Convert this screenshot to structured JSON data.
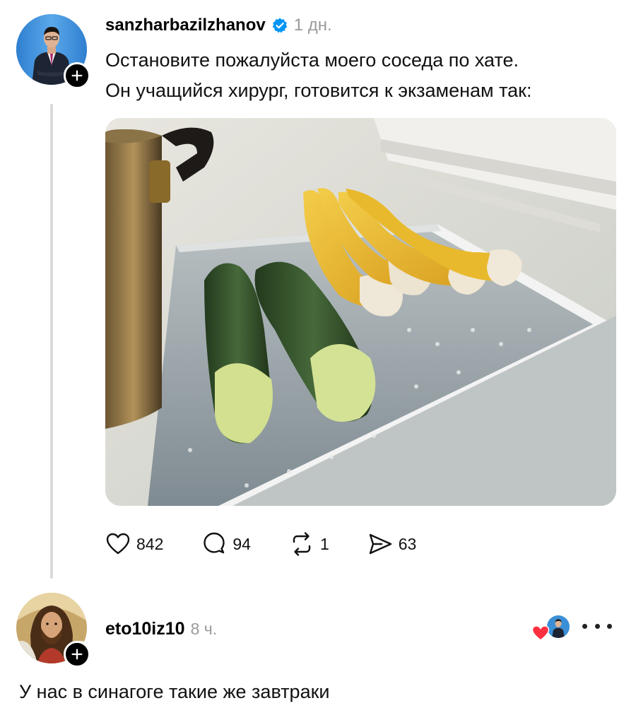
{
  "post": {
    "author": "sanzharbazilzhanov",
    "verified": true,
    "time": "1 дн.",
    "text_lines": [
      "Остановите пожалуйста моего соседа по хате.",
      "Он учащийся хирург, готовится к экзаменам так:"
    ],
    "avatar_icon": "man-in-suit-avatar",
    "image_icon": "fridge-peeled-cucumbers-bananas-photo",
    "actions": {
      "likes": "842",
      "comments": "94",
      "reposts": "1",
      "shares": "63"
    }
  },
  "reply": {
    "author": "eto10iz10",
    "time": "8 ч.",
    "text": "У нас в синагоге такие же завтраки",
    "avatar_icon": "painted-portrait-avatar",
    "liked_by_icon": "author-liked-heart-icon"
  },
  "colors": {
    "verified_blue": "#0095f6",
    "like_red": "#ff3040",
    "muted_text": "#9a9a9a"
  }
}
